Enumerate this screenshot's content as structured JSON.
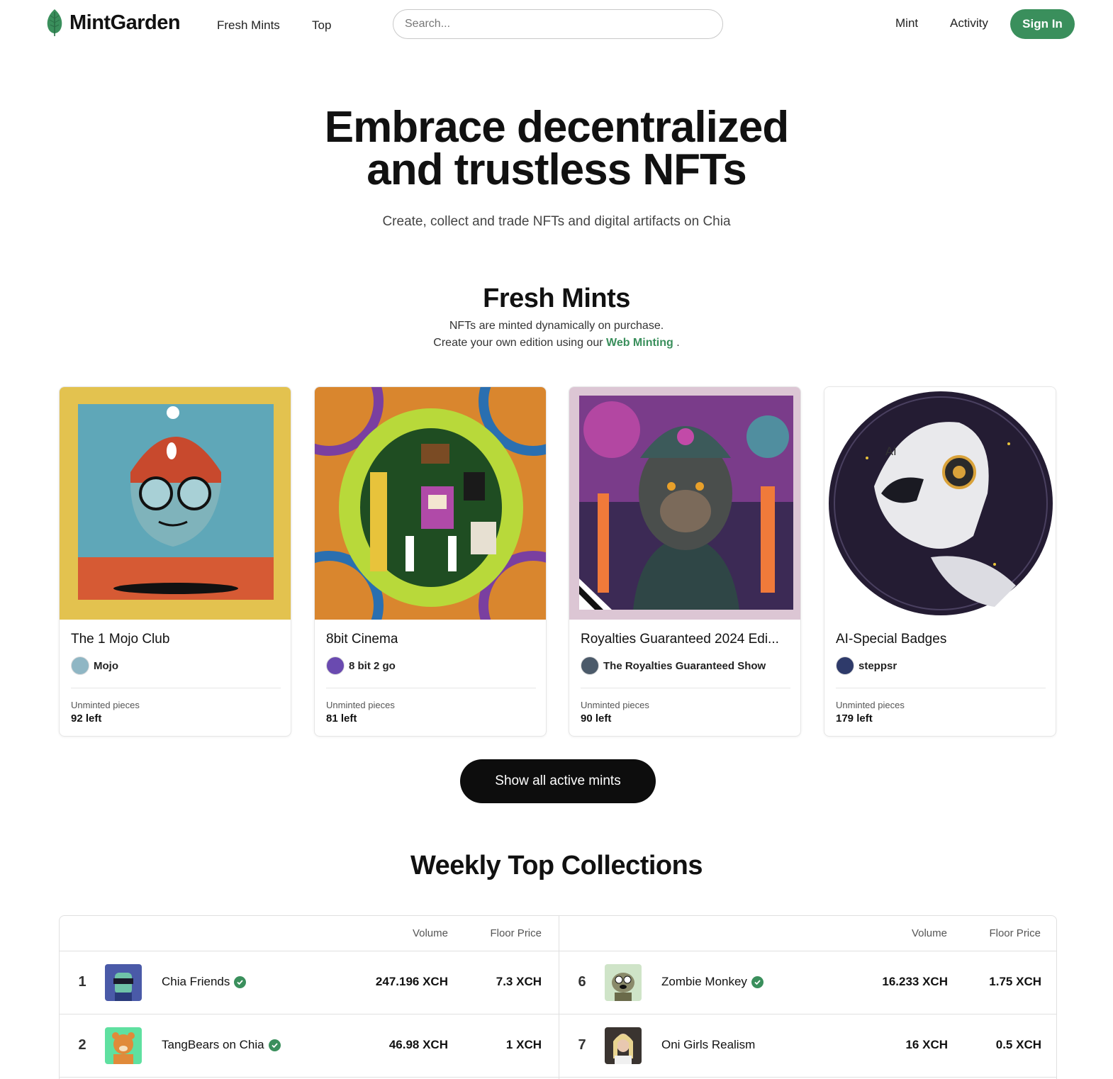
{
  "nav": {
    "logo_text": "MintGarden",
    "links": [
      "Fresh Mints",
      "Top"
    ],
    "search_placeholder": "Search...",
    "right_links": [
      "Mint",
      "Activity"
    ],
    "signin_label": "Sign In"
  },
  "hero": {
    "title_line1": "Embrace decentralized",
    "title_line2": "and trustless NFTs",
    "subtitle": "Create, collect and trade NFTs and digital artifacts on Chia"
  },
  "fresh_mints": {
    "title": "Fresh Mints",
    "desc_line1": "NFTs are minted dynamically on purchase.",
    "desc_line2_prefix": "Create your own edition using our",
    "desc_link": "Web Minting",
    "desc_line2_suffix": ".",
    "cards": [
      {
        "name": "The 1 Mojo Club",
        "creator": "Mojo",
        "unminted_label": "Unminted pieces",
        "left": "92 left"
      },
      {
        "name": "8bit Cinema",
        "creator": "8 bit 2 go",
        "unminted_label": "Unminted pieces",
        "left": "81 left"
      },
      {
        "name": "Royalties Guaranteed 2024 Edi...",
        "creator": "The Royalties Guaranteed Show",
        "unminted_label": "Unminted pieces",
        "left": "90 left"
      },
      {
        "name": "AI-Special Badges",
        "creator": "steppsr",
        "unminted_label": "Unminted pieces",
        "left": "179 left"
      }
    ],
    "show_all_label": "Show all active mints"
  },
  "top_collections": {
    "title": "Weekly Top Collections",
    "col_volume": "Volume",
    "col_floor": "Floor Price",
    "left_rows": [
      {
        "rank": "1",
        "name": "Chia Friends",
        "verified": true,
        "volume": "247.196 XCH",
        "floor": "7.3 XCH"
      },
      {
        "rank": "2",
        "name": "TangBears on Chia",
        "verified": true,
        "volume": "46.98 XCH",
        "floor": "1 XCH"
      }
    ],
    "right_rows": [
      {
        "rank": "6",
        "name": "Zombie Monkey",
        "verified": true,
        "volume": "16.233 XCH",
        "floor": "1.75 XCH"
      },
      {
        "rank": "7",
        "name": "Oni Girls Realism",
        "verified": false,
        "volume": "16 XCH",
        "floor": "0.5 XCH"
      }
    ]
  },
  "colors": {
    "accent": "#3a8f5c",
    "dark_button": "#0d0d0d"
  }
}
